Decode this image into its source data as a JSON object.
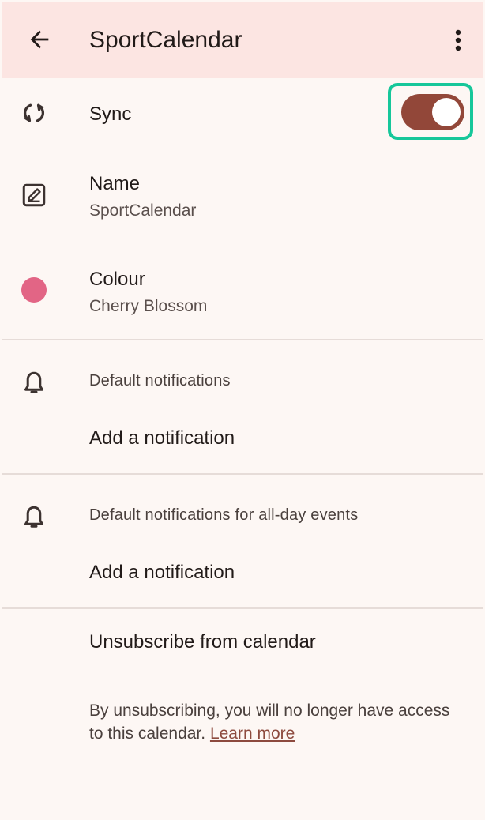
{
  "header": {
    "title": "SportCalendar",
    "back_icon": "arrow-back-icon",
    "more_icon": "more-vert-icon"
  },
  "sync": {
    "label": "Sync",
    "icon": "sync-icon",
    "enabled": true,
    "toggle_color": "#924739",
    "highlight_color": "#16c79a"
  },
  "name": {
    "label": "Name",
    "value": "SportCalendar",
    "icon": "edit-icon"
  },
  "colour": {
    "label": "Colour",
    "value": "Cherry Blossom",
    "swatch": "#e26585"
  },
  "notifications": {
    "section_label": "Default notifications",
    "add_label": "Add a notification",
    "icon": "bell-icon"
  },
  "allday_notifications": {
    "section_label": "Default notifications for all-day events",
    "add_label": "Add a notification",
    "icon": "bell-icon"
  },
  "unsubscribe": {
    "label": "Unsubscribe from calendar",
    "info": "By unsubscribing, you will no longer have access to this calendar.",
    "learn_more": "Learn more"
  },
  "colors": {
    "appbar_bg": "#fce5e2",
    "page_bg": "#fdf7f4",
    "link": "#8d4a3e"
  }
}
